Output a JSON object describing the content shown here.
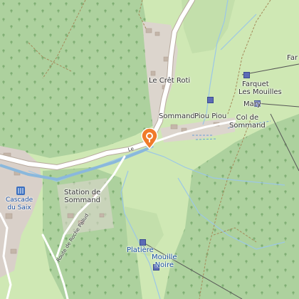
{
  "map": {
    "labels": {
      "le_cret_roti": "Le Crêt Roti",
      "sommand": "Sommand",
      "piou_piou": "Piou Piou",
      "farquet": "Farquet",
      "les_mouilles": "Les Mouilles",
      "mary": "Mary",
      "col_de_sommand": "Col de\nSommand",
      "far": "Far",
      "station_de_sommand": "Station de\nSommand",
      "cascade_du_saix": "Cascade\ndu Saix",
      "route_de_roche_pallud": "Route de Roche Pallud",
      "platiere": "Platière",
      "mouille_noire": "Mouille\nNoire",
      "le_road": "Le"
    },
    "colors": {
      "meadow": "#cfe8b4",
      "forest": "#add19e",
      "river": "#9cc7e6",
      "road": "#ffffff",
      "marker": "#f07b2a",
      "poi": "#5b6bb5"
    },
    "icons": {
      "marker": "map-pin-icon",
      "waterfall": "waterfall-icon"
    }
  }
}
